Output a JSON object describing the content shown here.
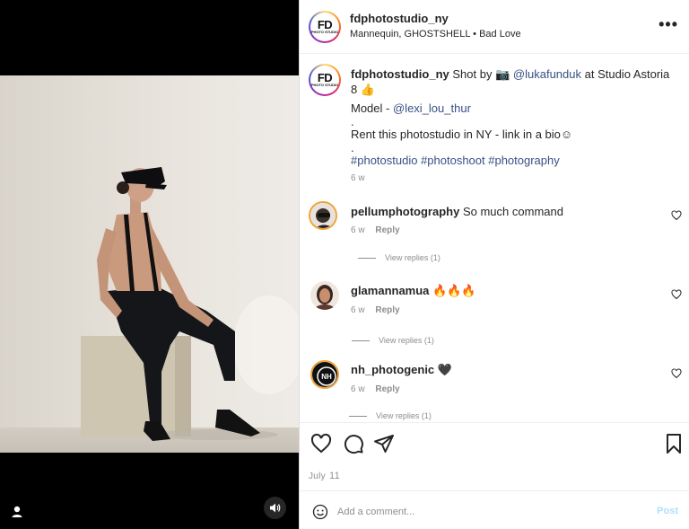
{
  "post": {
    "username": "fdphotostudio_ny",
    "audio": "Mannequin, GHOSTSHELL",
    "audio_sep": "•",
    "song": "Bad Love",
    "more_icon": "more-horizontal-icon",
    "avatar_text": "FD",
    "avatar_sub": "PHOTO STUDIO"
  },
  "caption": {
    "username": "fdphotostudio_ny",
    "text_1": "Shot by 📷",
    "mention_1": "@lukafunduk",
    "text_2": "at Studio Astoria 8 👍",
    "model_label": "Model -",
    "mention_2": "@lexi_lou_thur",
    "dot": ".",
    "promo": "Rent this photostudio in NY - link in a bio☺",
    "hashtags": "#photostudio #photoshoot #photography",
    "age": "6 w"
  },
  "comments": [
    {
      "username": "pellumphotography",
      "text": "So much command",
      "age": "6 w",
      "reply_label": "Reply",
      "view_replies": "View replies (1)"
    },
    {
      "username": "glamannamua",
      "text": "🔥🔥🔥",
      "age": "6 w",
      "reply_label": "Reply",
      "view_replies": "View replies (1)"
    },
    {
      "username": "nh_photogenic",
      "text": "🖤",
      "age": "6 w",
      "reply_label": "Reply",
      "view_replies": "View replies (1)"
    }
  ],
  "actions": {
    "like_icon": "heart-icon",
    "comment_icon": "comment-icon",
    "share_icon": "send-icon",
    "save_icon": "bookmark-icon"
  },
  "date": {
    "month": "July",
    "day": "11"
  },
  "add_comment": {
    "placeholder": "Add a comment...",
    "post_label": "Post",
    "emoji_icon": "smiley-icon"
  },
  "media": {
    "user_tag_icon": "user-icon",
    "sound_icon": "speaker-icon"
  },
  "colors": {
    "link": "#385185",
    "muted": "#8e8e8e",
    "post_disabled": "#b2dffc"
  }
}
